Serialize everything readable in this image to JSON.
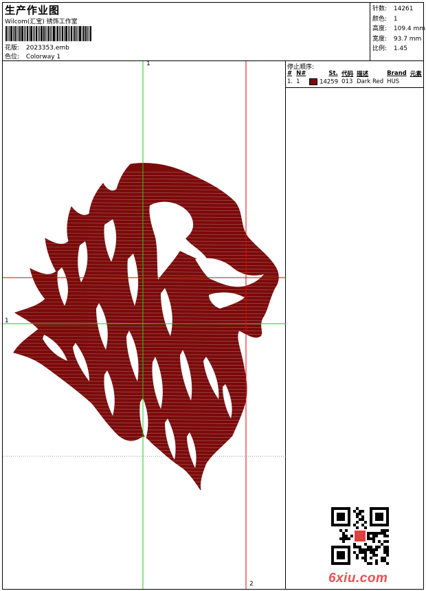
{
  "header": {
    "title": "生产作业图",
    "subtitle": "Wilcom(汇宝) 绣饰工作室",
    "design_label": "花版:",
    "design_value": "2023353.emb",
    "colorway_label": "色位:",
    "colorway_value": "Colorway 1"
  },
  "stats": [
    {
      "label": "针数:",
      "value": "14261"
    },
    {
      "label": "颜色:",
      "value": "1"
    },
    {
      "label": "高度:",
      "value": "109.4 mm"
    },
    {
      "label": "宽度:",
      "value": "93.7 mm"
    },
    {
      "label": "比例:",
      "value": "1.45"
    }
  ],
  "stop_sequence": {
    "title": "停止顺序:",
    "columns": [
      "#",
      "N#",
      "St.",
      "代码",
      "描述",
      "Brand",
      "元素"
    ],
    "rows": [
      {
        "num": "1.",
        "n": "1",
        "color": "#7b0a0a",
        "stitches": "14259",
        "code": "013",
        "description": "Dark Red",
        "brand": "HUS",
        "element": ""
      }
    ]
  },
  "guides": {
    "top_label": "1",
    "left_label": "1",
    "bottom_label": "2"
  },
  "design_color": "#7b0a0a",
  "watermark": "6xiu.com"
}
